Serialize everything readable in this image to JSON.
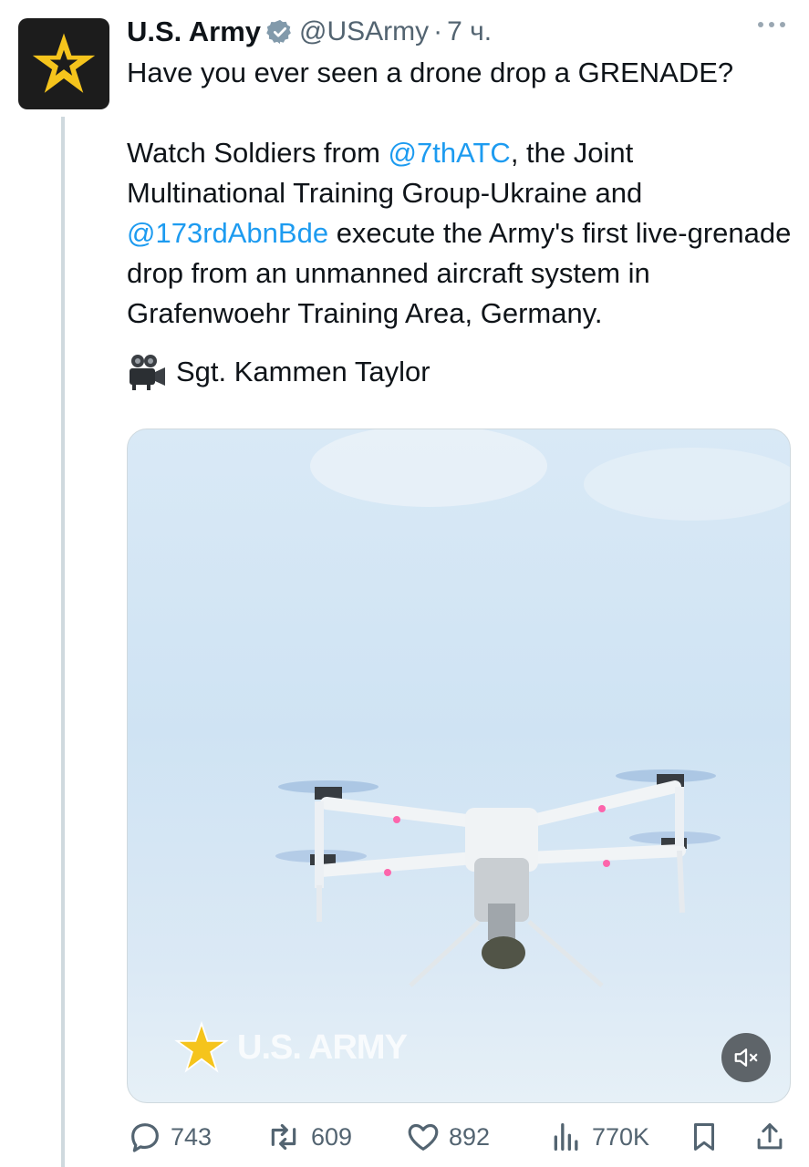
{
  "tweet": {
    "author_name": "U.S. Army",
    "author_handle": "@USArmy",
    "separator": "·",
    "time": "7 ч.",
    "line1": "Have you ever seen a drone drop a GRENADE?",
    "p2_a": "Watch Soldiers from ",
    "mention1": "@7thATC",
    "p2_b": ", the Joint Multinational Training Group-Ukraine and ",
    "mention2": "@173rdAbnBde",
    "p2_c": " execute the Army's first live-grenade drop from an unmanned aircraft system in Grafenwoehr Training Area, Germany.",
    "credit": "Sgt. Kammen Taylor"
  },
  "media": {
    "watermark": "U.S. ARMY"
  },
  "stats": {
    "replies": "743",
    "reposts": "609",
    "likes": "892",
    "views": "770K"
  },
  "colors": {
    "accent": "#1d9bf0",
    "secondary_text": "#536471",
    "star": "#f5c41c"
  }
}
